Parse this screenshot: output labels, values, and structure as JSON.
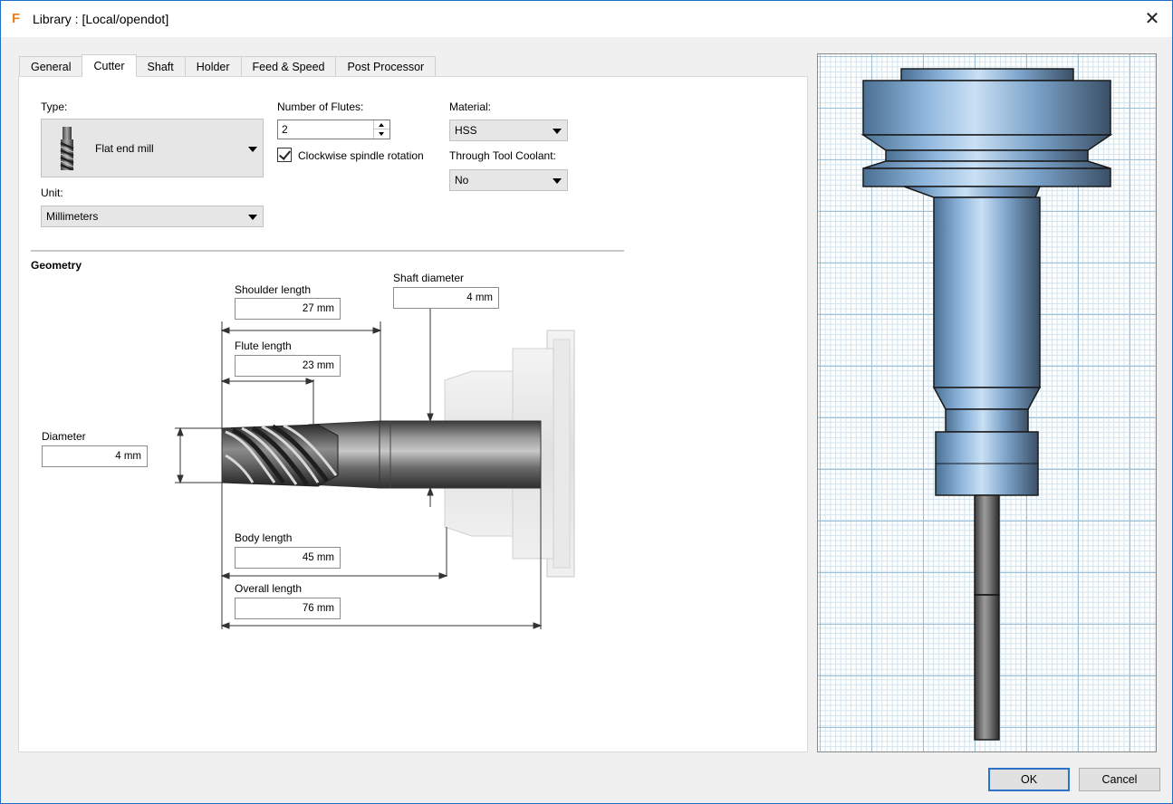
{
  "window": {
    "title": "Library :  [Local/opendot]",
    "app_icon_glyph": "F",
    "close_glyph": "✕"
  },
  "tabs": [
    {
      "label": "General",
      "active": false
    },
    {
      "label": "Cutter",
      "active": true
    },
    {
      "label": "Shaft",
      "active": false
    },
    {
      "label": "Holder",
      "active": false
    },
    {
      "label": "Feed & Speed",
      "active": false
    },
    {
      "label": "Post Processor",
      "active": false
    }
  ],
  "cutter": {
    "type_label": "Type:",
    "type_value": "Flat end mill",
    "unit_label": "Unit:",
    "unit_value": "Millimeters",
    "flutes_label": "Number of Flutes:",
    "flutes_value": "2",
    "clockwise_label": "Clockwise spindle rotation",
    "clockwise_checked": true,
    "material_label": "Material:",
    "material_value": "HSS",
    "coolant_label": "Through Tool Coolant:",
    "coolant_value": "No"
  },
  "geometry": {
    "title": "Geometry",
    "shoulder_length": {
      "label": "Shoulder length",
      "value": "27 mm"
    },
    "shaft_diameter": {
      "label": "Shaft diameter",
      "value": "4 mm"
    },
    "flute_length": {
      "label": "Flute length",
      "value": "23 mm"
    },
    "diameter": {
      "label": "Diameter",
      "value": "4 mm"
    },
    "body_length": {
      "label": "Body length",
      "value": "45 mm"
    },
    "overall_length": {
      "label": "Overall length",
      "value": "76 mm"
    }
  },
  "buttons": {
    "ok": "OK",
    "cancel": "Cancel"
  },
  "colors": {
    "accent": "#2a73c8",
    "tool_blue": "#7fa7cf",
    "tool_dark": "#555555"
  }
}
